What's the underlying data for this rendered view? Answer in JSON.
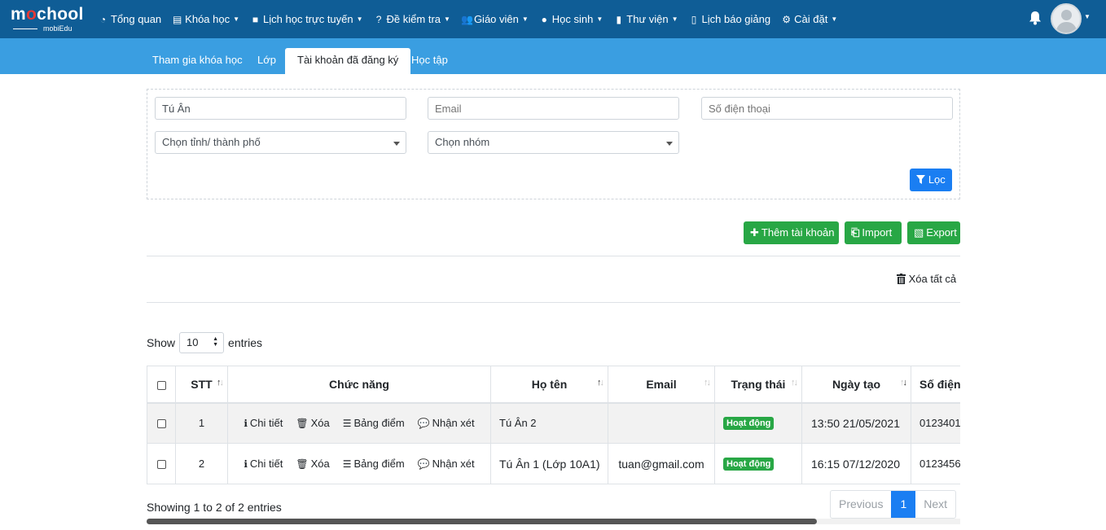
{
  "brand": {
    "name_pre": "m",
    "name_o": "o",
    "name_post": "chool",
    "sub": "mobiEdu"
  },
  "nav": [
    {
      "label": "Tổng quan",
      "icon": "◔",
      "caret": false
    },
    {
      "label": "Khóa học",
      "icon": "▤",
      "caret": true
    },
    {
      "label": "Lịch học trực tuyến",
      "icon": "■",
      "caret": true
    },
    {
      "label": "Đề kiểm tra",
      "icon": "?",
      "caret": true
    },
    {
      "label": "Giáo viên",
      "icon": "👥",
      "caret": true
    },
    {
      "label": "Học sinh",
      "icon": "●",
      "caret": true
    },
    {
      "label": "Thư viện",
      "icon": "▮",
      "caret": true
    },
    {
      "label": "Lịch báo giảng",
      "icon": "▯",
      "caret": false
    },
    {
      "label": "Cài đặt",
      "icon": "⚙",
      "caret": true
    }
  ],
  "tabs": [
    {
      "label": "Tham gia khóa học"
    },
    {
      "label": "Lớp"
    },
    {
      "label": "Tài khoản đã đăng ký"
    },
    {
      "label": "Học tập"
    }
  ],
  "filter": {
    "name_value": "Tú Ân",
    "email_placeholder": "Email",
    "phone_placeholder": "Số điện thoại",
    "province_placeholder": "Chọn tỉnh/ thành phố",
    "group_placeholder": "Chọn nhóm",
    "filter_button": "Lọc"
  },
  "actions": {
    "add_account": "Thêm tài khoản",
    "import": "Import",
    "export": "Export",
    "delete_all": "Xóa tất cả"
  },
  "length": {
    "show": "Show",
    "value": "10",
    "entries": "entries"
  },
  "table": {
    "headers": {
      "stt": "STT",
      "functions": "Chức năng",
      "name": "Họ tên",
      "email": "Email",
      "status": "Trạng thái",
      "created": "Ngày tạo",
      "phone": "Số điện"
    },
    "action_labels": {
      "detail": "Chi tiết",
      "delete": "Xóa",
      "scores": "Bảng điểm",
      "comment": "Nhận xét"
    },
    "rows": [
      {
        "stt": "1",
        "name": "Tú Ân 2",
        "email": "",
        "status": "Hoạt động",
        "created": "13:50 21/05/2021",
        "phone": "0123401"
      },
      {
        "stt": "2",
        "name": "Tú Ân 1 (Lớp 10A1)",
        "email": "tuan@gmail.com",
        "status": "Hoạt động",
        "created": "16:15 07/12/2020",
        "phone": "0123456"
      }
    ]
  },
  "footer": {
    "info": "Showing 1 to 2 of 2 entries",
    "previous": "Previous",
    "current_page": "1",
    "next": "Next"
  },
  "colors": {
    "navbar": "#0f5d96",
    "tabbar": "#3a9ee1",
    "primary": "#1a7ef2",
    "success": "#28a745"
  }
}
